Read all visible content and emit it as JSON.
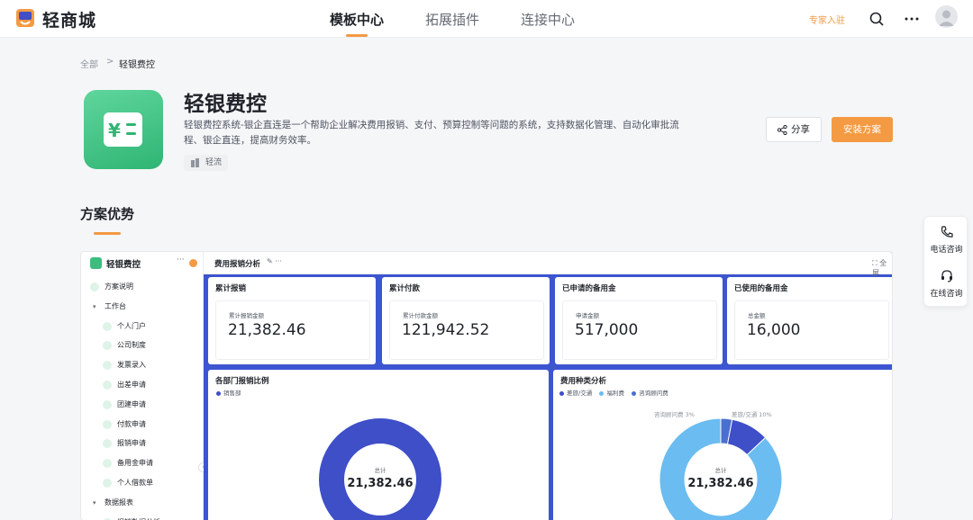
{
  "nav": {
    "brand": "轻商城",
    "tabs": [
      "模板中心",
      "拓展插件",
      "连接中心"
    ],
    "expert_entry": "专家入驻"
  },
  "breadcrumb": {
    "root": "全部",
    "separator": ">",
    "current": "轻银费控"
  },
  "app": {
    "title": "轻银费控",
    "description": "轻银费控系统-银企直连是一个帮助企业解决费用报销、支付、预算控制等问题的系统，支持数据化管理、自动化审批流程、银企直连，提高财务效率。",
    "tag": "轻流",
    "share_label": "分享",
    "install_label": "安装方案"
  },
  "section": {
    "title": "方案优势"
  },
  "preview": {
    "sidebar_title": "轻银费控",
    "sidebar_more": "···",
    "sidebar_items": [
      {
        "label": "方案说明",
        "type": "item",
        "level": 0
      },
      {
        "label": "工作台",
        "type": "group",
        "level": 0
      },
      {
        "label": "个人门户",
        "type": "item",
        "level": 1
      },
      {
        "label": "公司制度",
        "type": "item",
        "level": 1
      },
      {
        "label": "发票录入",
        "type": "item",
        "level": 1
      },
      {
        "label": "出差申请",
        "type": "item",
        "level": 1
      },
      {
        "label": "团建申请",
        "type": "item",
        "level": 1
      },
      {
        "label": "付款申请",
        "type": "item",
        "level": 1
      },
      {
        "label": "报销申请",
        "type": "item",
        "level": 1
      },
      {
        "label": "备用金申请",
        "type": "item",
        "level": 1
      },
      {
        "label": "个人借款单",
        "type": "item",
        "level": 1
      },
      {
        "label": "数据报表",
        "type": "group",
        "level": 0
      },
      {
        "label": "报销数据分析",
        "type": "item",
        "level": 1
      }
    ],
    "toolbar_title": "费用报销分析",
    "toolbar_more": "✎  ···",
    "fullscreen": "⛶ 全屏",
    "stat_cards": [
      {
        "title": "累计报销",
        "label": "累计报销金额",
        "value": "21,382.46"
      },
      {
        "title": "累计付款",
        "label": "累计付款金额",
        "value": "121,942.52"
      },
      {
        "title": "已申请的备用金",
        "label": "申请金额",
        "value": "517,000"
      },
      {
        "title": "已使用的备用金",
        "label": "总金额",
        "value": "16,000"
      }
    ],
    "charts": [
      {
        "title": "各部门报销比例",
        "legend": [
          {
            "name": "销售部",
            "color": "#3e4fc8"
          }
        ],
        "center_label": "总计",
        "center_value": "21,382.46"
      },
      {
        "title": "费用种类分析",
        "legend": [
          {
            "name": "差旅/交通",
            "color": "#3e4fc8"
          },
          {
            "name": "福利费",
            "color": "#6bbcf0"
          },
          {
            "name": "咨询顾问费",
            "color": "#4a6fd0"
          }
        ],
        "center_label": "总计",
        "center_value": "21,382.46",
        "slice_labels": [
          "咨询顾问费 3%",
          "差旅/交通 10%"
        ]
      }
    ]
  },
  "chart_data": [
    {
      "type": "pie",
      "title": "各部门报销比例",
      "categories": [
        "销售部"
      ],
      "values": [
        100
      ]
    },
    {
      "type": "pie",
      "title": "费用种类分析",
      "categories": [
        "差旅/交通",
        "福利费",
        "咨询顾问费"
      ],
      "values": [
        10,
        87,
        3
      ]
    }
  ],
  "float": {
    "phone": "电话咨询",
    "online": "在线咨询"
  },
  "colors": {
    "accent": "#f39a42",
    "brand_green": "#3ebc7e",
    "dashboard_blue": "#3c55d0"
  }
}
